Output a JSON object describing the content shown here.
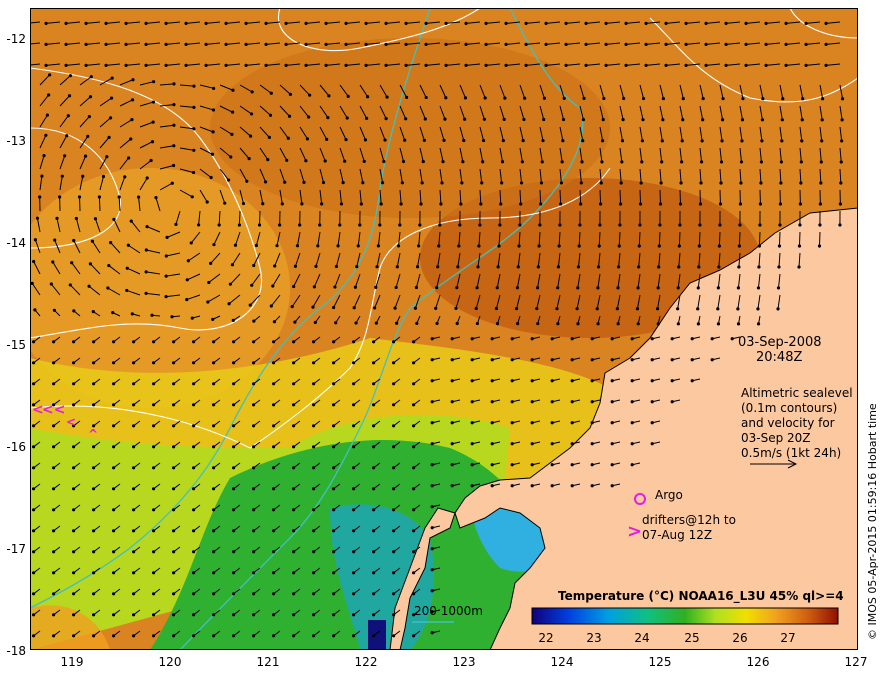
{
  "map": {
    "date": "03-Sep-2008",
    "time": "20:48Z",
    "altimetry_lines": [
      "Altimetric sealevel",
      "(0.1m contours)",
      "and velocity for",
      "03-Sep 20Z",
      "0.5m/s (1kt 24h)"
    ],
    "argo_label": "Argo",
    "drifters_lines": [
      "drifters@12h to",
      "07-Aug 12Z"
    ],
    "depth_label": "200  1000m",
    "colorbar_title": "Temperature (°C) NOAA16_L3U 45% ql>=4",
    "colorbar_ticks": [
      "22",
      "23",
      "24",
      "25",
      "26",
      "27"
    ],
    "credit": "© IMOS 05-Apr-2015 01:59:16 Hobart time",
    "lat_ticks": [
      "-12",
      "-13",
      "-14",
      "-15",
      "-16",
      "-17",
      "-18"
    ],
    "lon_ticks": [
      "119",
      "120",
      "121",
      "122",
      "123",
      "124",
      "125",
      "126",
      "127"
    ],
    "colors": {
      "land": "#fcc8a0",
      "isobath": "#40c0c0",
      "contour": "#ffffff",
      "argo": "#e020e0",
      "warm": "#c86a10",
      "cool": "#20a020"
    }
  }
}
